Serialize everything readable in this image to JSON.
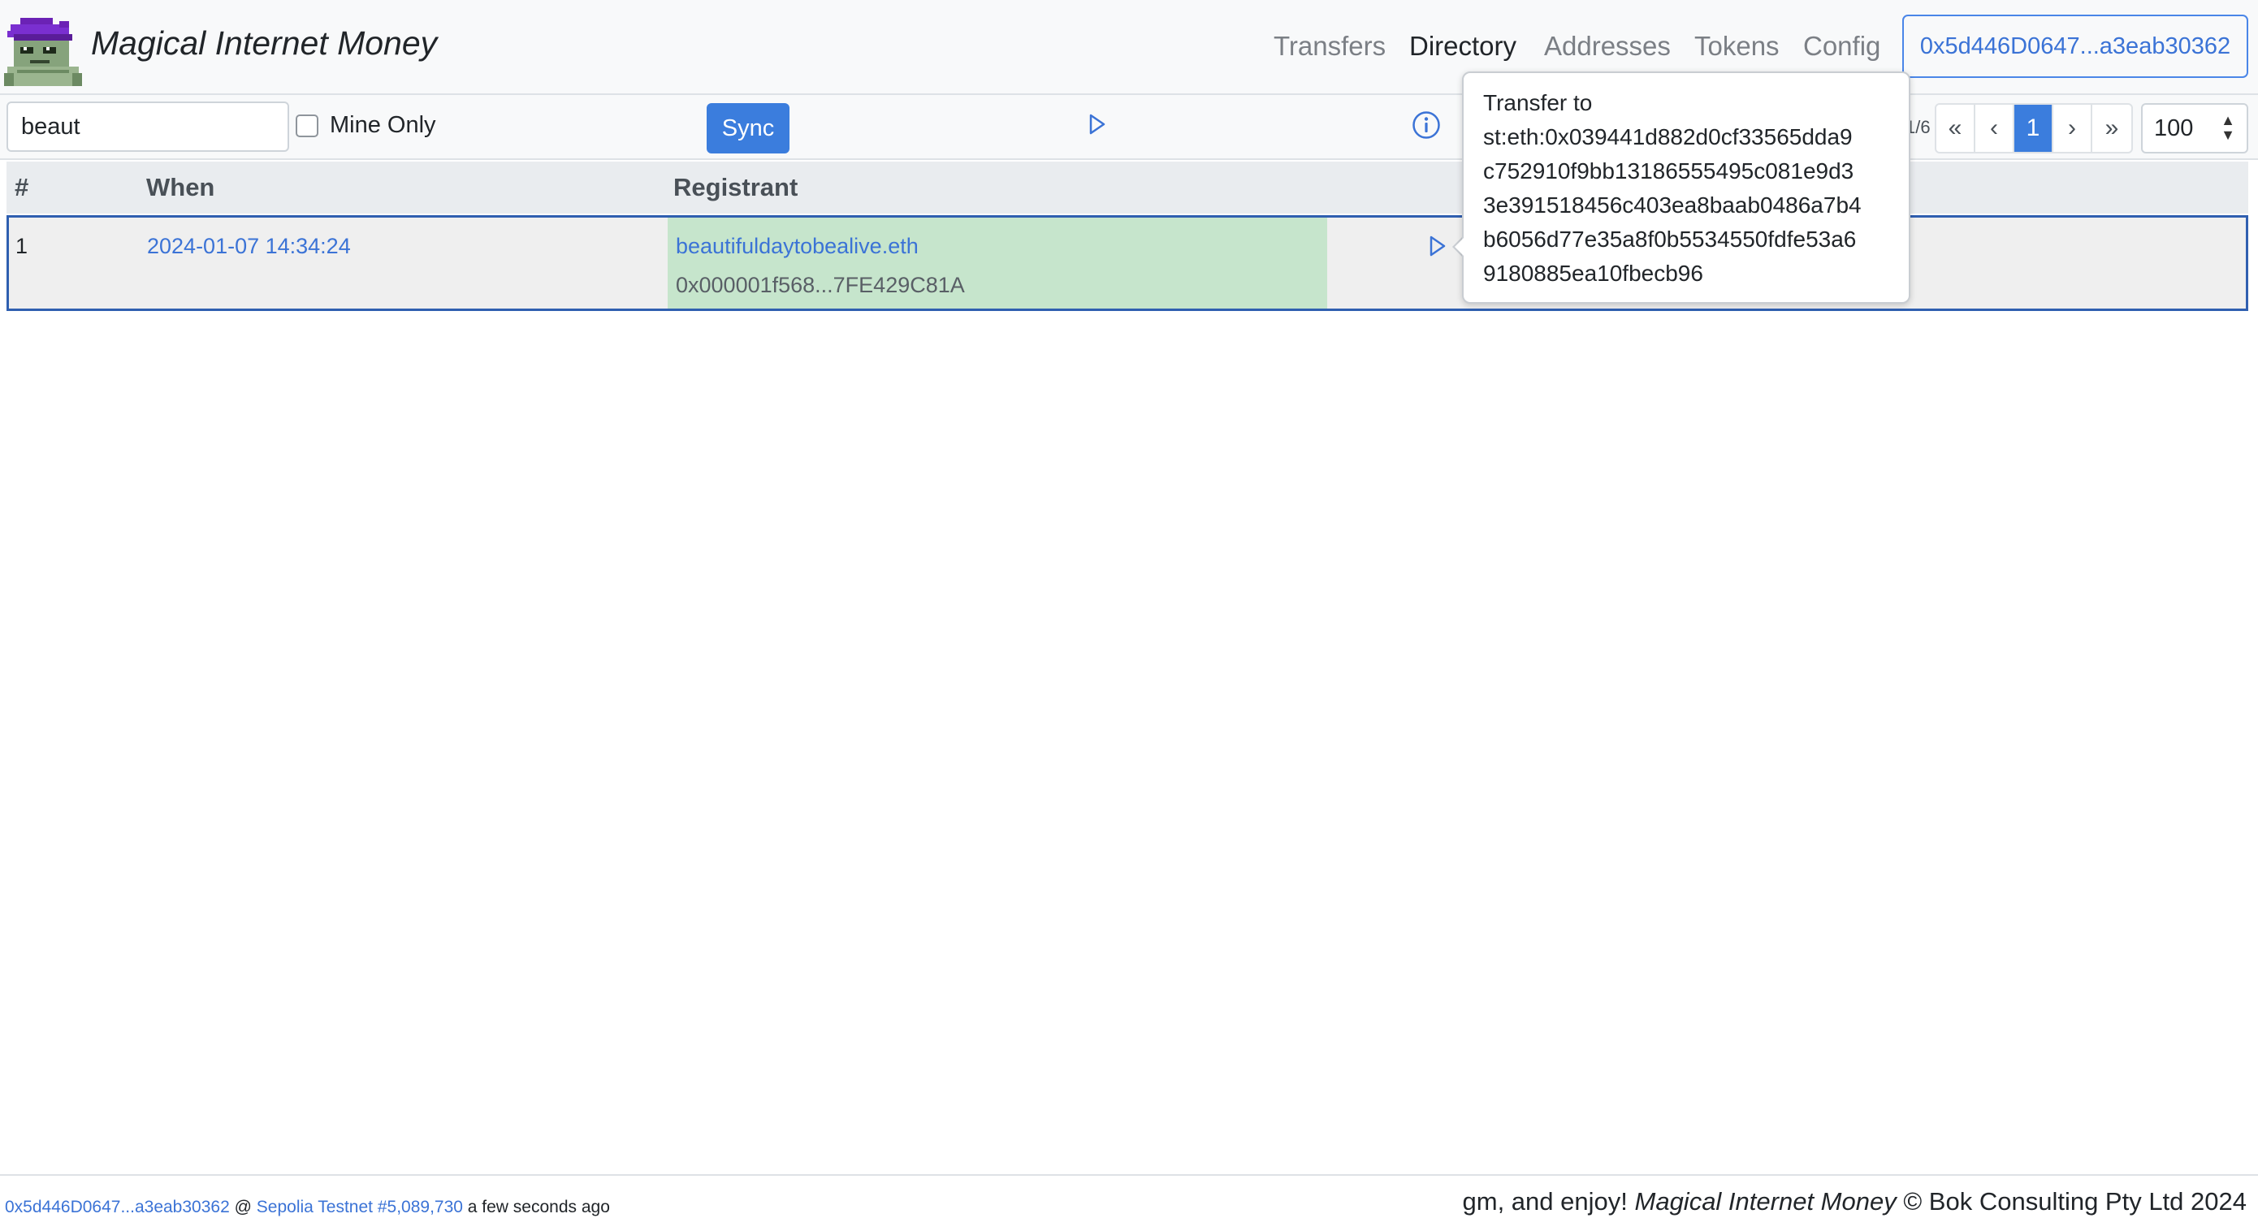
{
  "header": {
    "brand": "Magical Internet Money",
    "nav": [
      {
        "label": "Transfers",
        "active": false
      },
      {
        "label": "Directory",
        "active": true
      },
      {
        "label": "Addresses",
        "active": false
      },
      {
        "label": "Tokens",
        "active": false
      },
      {
        "label": "Config",
        "active": false
      }
    ],
    "account": "0x5d446D0647...a3eab30362"
  },
  "toolbar": {
    "search_value": "beaut",
    "mine_only_label": "Mine Only",
    "sync_label": "Sync",
    "page_count": "1/6",
    "pager": {
      "first": "«",
      "prev": "‹",
      "current": "1",
      "next": "›",
      "last": "»"
    },
    "per_page": "100"
  },
  "table": {
    "headers": {
      "index": "#",
      "when": "When",
      "registrant": "Registrant"
    },
    "rows": [
      {
        "index": "1",
        "when": "2024-01-07 14:34:24",
        "registrant_name": "beautifuldaytobealive.eth",
        "registrant_address": "0x000001f568...7FE429C81A"
      }
    ]
  },
  "tooltip": {
    "title": "Transfer to",
    "lines": [
      "st:eth:0x039441d882d0cf33565dda9",
      "c752910f9bb13186555495c081e9d3",
      "3e391518456c403ea8baab0486a7b4",
      "b6056d77e35a8f0b5534550fdfe53a6",
      "9180885ea10fbecb96"
    ]
  },
  "footer": {
    "account": "0x5d446D0647...a3eab30362",
    "at": "@",
    "network": "Sepolia Testnet #5,089,730",
    "updated": "a few seconds ago",
    "greeting": "gm, and enjoy!",
    "brand": "Magical Internet Money",
    "copyright": "© Bok Consulting Pty Ltd 2024"
  },
  "colors": {
    "accent": "#3b7ddd",
    "link": "#3b73d6",
    "registrant_highlight": "#c6e5cc",
    "row_border": "#2f5fb0"
  },
  "icons": {
    "logo": "wizard-avatar-icon",
    "play": "play-triangle-icon",
    "info": "info-circle-icon"
  }
}
